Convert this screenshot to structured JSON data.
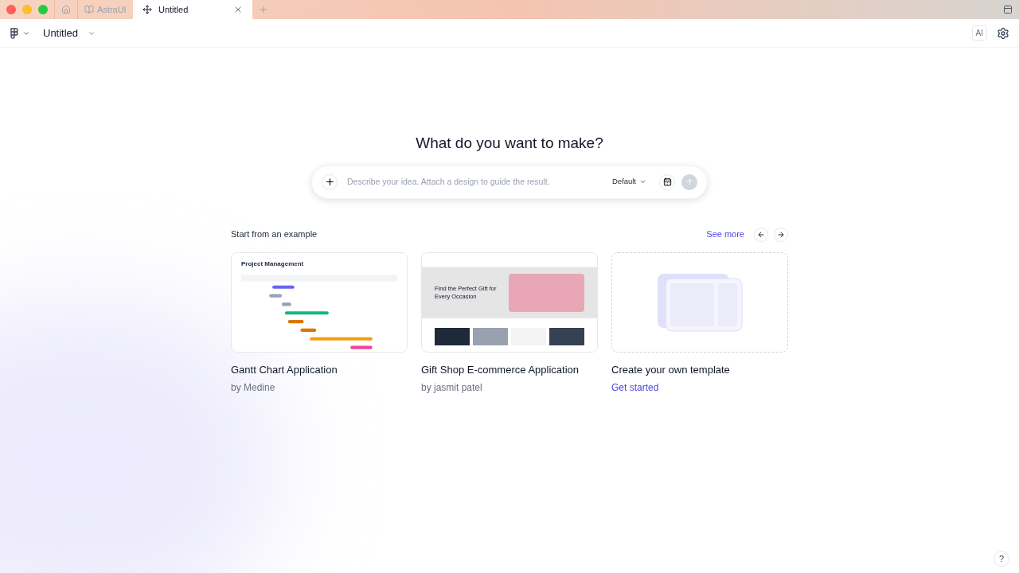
{
  "tabs": [
    {
      "label": "AstraUI",
      "selected": false
    },
    {
      "label": "Untitled",
      "selected": true
    }
  ],
  "header": {
    "title": "Untitled",
    "ai_badge": "AI"
  },
  "prompt": {
    "heading": "What do you want to make?",
    "placeholder": "Describe your idea. Attach a design to guide the result.",
    "mode": "Default"
  },
  "examples": {
    "heading": "Start from an example",
    "see_more": "See more",
    "cards": [
      {
        "kind": "gantt",
        "title": "Gantt Chart Application",
        "author": "by Medine",
        "preview_title": "Project Management"
      },
      {
        "kind": "shop",
        "title": "Gift Shop E-commerce Application",
        "author": "by jasmit patel",
        "preview_title": "Find the Perfect Gift for Every Occasion"
      },
      {
        "kind": "template",
        "title": "Create your own template",
        "link": "Get started"
      }
    ]
  },
  "help": "?"
}
